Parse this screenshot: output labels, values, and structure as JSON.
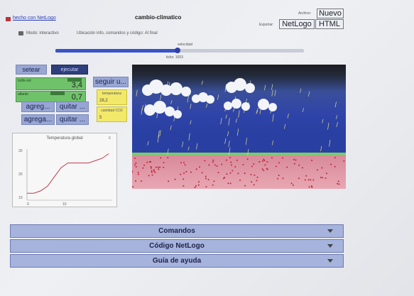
{
  "header": {
    "made_with": "hecho con NetLogo",
    "title": "cambio-climatico",
    "mode_text": "Modo: interactivo",
    "location_text": "Ubicación info, comandos y código: Al final",
    "file_label": "Archivo:",
    "new_label": "Nuevo",
    "export_label": "Exportar:",
    "export_netlogo": "NetLogo",
    "export_html": "HTML"
  },
  "speed": {
    "label": "velocidad",
    "ticks": "ticks: 1653",
    "value": 0.49
  },
  "controls": {
    "setup_label": "setear",
    "go_label": "ejecutar",
    "follow_label": "seguir u...",
    "slider1": {
      "label": "brillo-sol",
      "value": "3,4"
    },
    "slider2": {
      "label": "albedo",
      "value": "0,7"
    },
    "add_cloud": "agreg...",
    "remove_cloud": "quitar ...",
    "add_co2": "agrega...",
    "remove_co2": "quitar ..."
  },
  "monitors": {
    "temperature": {
      "label": "temperatura",
      "value": "28,2"
    },
    "co2": {
      "label": "cantidad CO2",
      "value": "5"
    }
  },
  "plot": {
    "title": "Temperatura global",
    "y_ticks": [
      "30",
      "20",
      "10"
    ],
    "x_ticks": [
      "0",
      "10"
    ]
  },
  "chart_data": {
    "type": "line",
    "title": "Temperatura global",
    "x": [
      0,
      2,
      4,
      6,
      8,
      10,
      12,
      14,
      16,
      18,
      20,
      22,
      24
    ],
    "y": [
      12,
      12,
      13,
      15,
      19,
      23,
      25,
      25,
      25,
      25,
      26,
      27,
      29
    ],
    "xlim": [
      0,
      25
    ],
    "ylim": [
      9,
      31
    ]
  },
  "sections": [
    {
      "label": "Comandos"
    },
    {
      "label": "Código NetLogo"
    },
    {
      "label": "Guía de ayuda"
    }
  ]
}
